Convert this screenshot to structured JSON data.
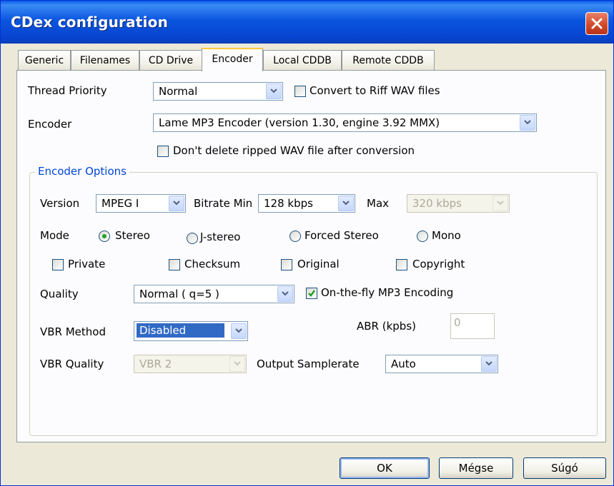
{
  "window": {
    "title": "CDex configuration"
  },
  "tabs": [
    "Generic",
    "Filenames",
    "CD Drive",
    "Encoder",
    "Local CDDB",
    "Remote CDDB"
  ],
  "active_tab": "Encoder",
  "general": {
    "thread_priority_label": "Thread Priority",
    "thread_priority_value": "Normal",
    "convert_riff_label": "Convert to Riff WAV files",
    "convert_riff_checked": false,
    "encoder_label": "Encoder",
    "encoder_value": "Lame MP3 Encoder (version 1.30, engine 3.92 MMX)",
    "dont_delete_label": "Don't delete ripped WAV file after conversion",
    "dont_delete_checked": false
  },
  "encoder_options": {
    "group_label": "Encoder Options",
    "version_label": "Version",
    "version_value": "MPEG I",
    "bitrate_min_label": "Bitrate Min",
    "bitrate_min_value": "128 kbps",
    "max_label": "Max",
    "max_value": "320 kbps",
    "mode_label": "Mode",
    "modes": [
      "Stereo",
      "J-stereo",
      "Forced Stereo",
      "Mono"
    ],
    "mode_selected": "Stereo",
    "flags": [
      {
        "label": "Private",
        "checked": false
      },
      {
        "label": "Checksum",
        "checked": false
      },
      {
        "label": "Original",
        "checked": false
      },
      {
        "label": "Copyright",
        "checked": false
      }
    ],
    "quality_label": "Quality",
    "quality_value": "Normal ( q=5 )",
    "on_the_fly_label": "On-the-fly MP3 Encoding",
    "on_the_fly_checked": true,
    "vbr_method_label": "VBR Method",
    "vbr_method_value": "Disabled",
    "abr_label": "ABR (kpbs)",
    "abr_value": "0",
    "vbr_quality_label": "VBR Quality",
    "vbr_quality_value": "VBR 2",
    "output_samplerate_label": "Output Samplerate",
    "output_samplerate_value": "Auto"
  },
  "buttons": {
    "ok": "OK",
    "cancel": "Mégse",
    "help": "Súgó"
  },
  "colors": {
    "title_bar": "#0a5ce8",
    "group_label": "#0046d5",
    "check_mark": "#21a121",
    "close_button": "#d24a2b"
  }
}
